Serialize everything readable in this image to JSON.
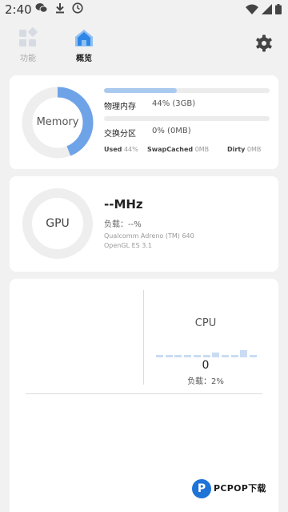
{
  "status_bar": {
    "time": "2:40",
    "left_icons": [
      "wechat-icon",
      "download-icon",
      "clock-icon"
    ],
    "right_icons": [
      "wifi-icon",
      "signal-icon",
      "battery-icon"
    ]
  },
  "nav": {
    "tabs": [
      {
        "label": "功能",
        "icon": "grid-icon",
        "active": false
      },
      {
        "label": "概览",
        "icon": "home-icon",
        "active": true
      }
    ],
    "settings_icon": "gear-icon"
  },
  "memory": {
    "ring_label": "Memory",
    "ring_percent": 44,
    "physical": {
      "label": "物理内存",
      "value": "44% (3GB)",
      "percent": 44
    },
    "swap": {
      "label": "交换分区",
      "value": "0% (0MB)",
      "percent": 0
    },
    "stats": [
      {
        "name": "Used",
        "value": "44%"
      },
      {
        "name": "SwapCached",
        "value": "0MB"
      },
      {
        "name": "Dirty",
        "value": "0MB"
      }
    ]
  },
  "gpu": {
    "ring_label": "GPU",
    "frequency": "--MHz",
    "load": "负载：--%",
    "model": "Qualcomm Adreno (TM) 640",
    "gl_version": "OpenGL ES 3.1"
  },
  "cpu": {
    "title": "CPU",
    "value": "0",
    "load": "负载：2%",
    "history": [
      1,
      1,
      1,
      1,
      1,
      1,
      2,
      1,
      1,
      3,
      1
    ]
  },
  "watermark": {
    "logo_letter": "P",
    "text": "PCPOP下载"
  },
  "colors": {
    "accent": "#6fa3e8",
    "bar_fill": "#a9c9ef",
    "ring_track": "#eeeeee"
  }
}
